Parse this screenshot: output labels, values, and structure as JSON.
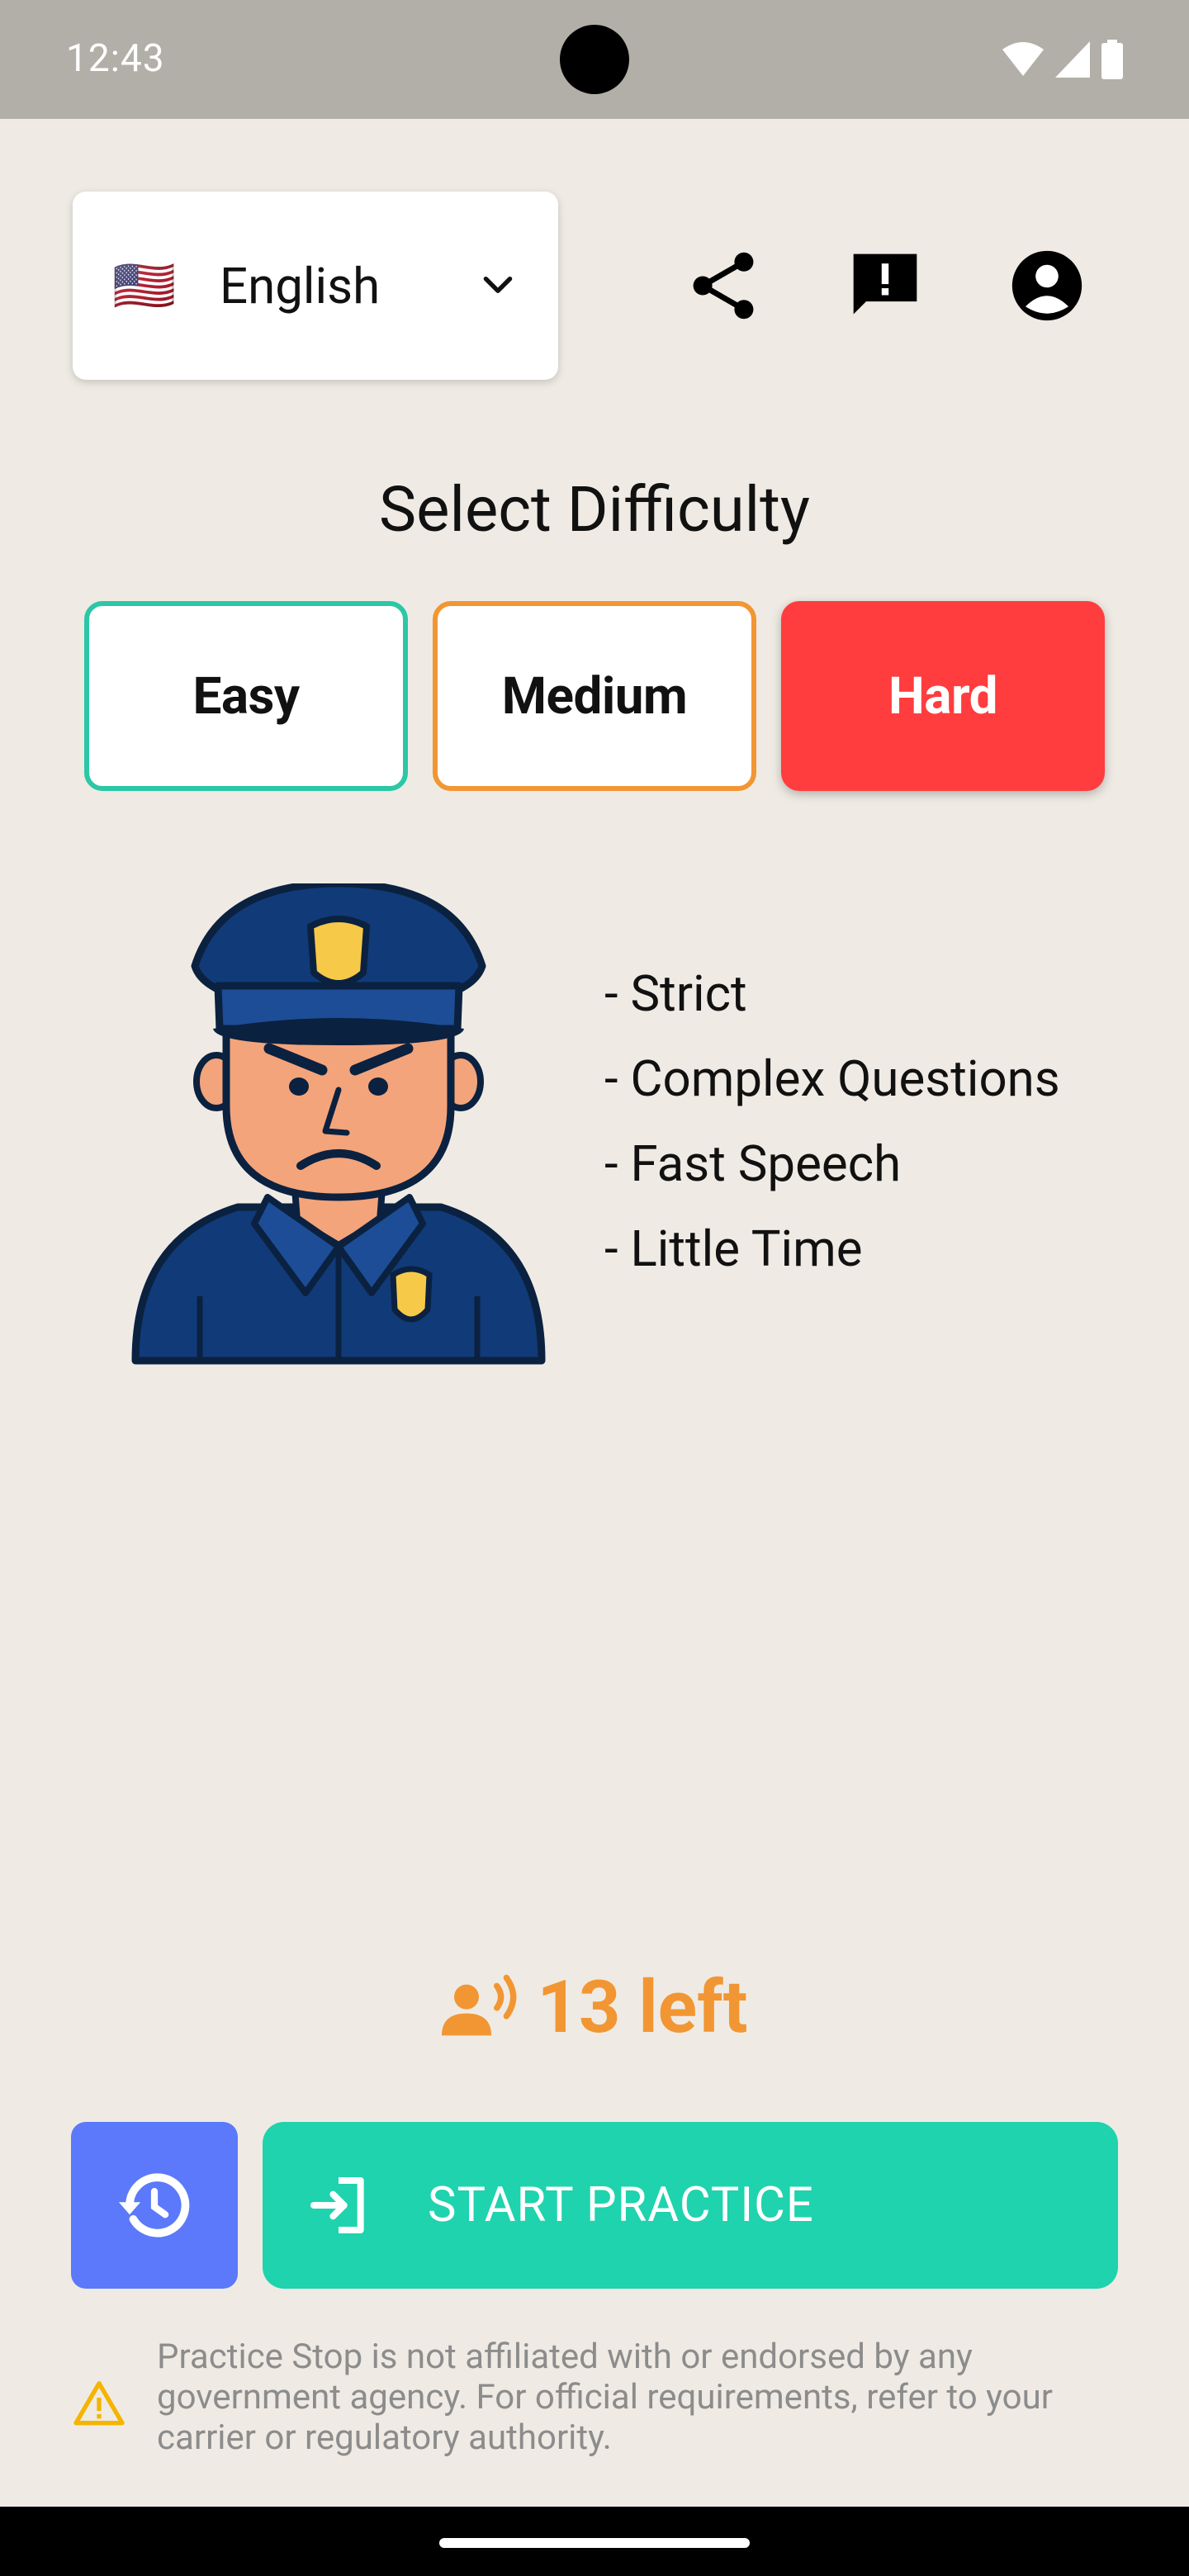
{
  "status_bar": {
    "time": "12:43"
  },
  "language": {
    "flag": "🇺🇸",
    "label": "English"
  },
  "header_icons": [
    "share-icon",
    "feedback-icon",
    "account-icon"
  ],
  "title": "Select Difficulty",
  "difficulty": {
    "easy": "Easy",
    "medium": "Medium",
    "hard": "Hard",
    "selected": "Hard"
  },
  "traits": [
    "- Strict",
    "- Complex Questions",
    "- Fast Speech",
    "- Little Time"
  ],
  "remaining": {
    "text": "13 left"
  },
  "actions": {
    "start_label": "START PRACTICE"
  },
  "disclaimer": "Practice Stop is not affiliated with or endorsed by any government agency. For official requirements, refer to your carrier or regulatory authority.",
  "colors": {
    "background": "#EFEBE4",
    "easy_border": "#2BC7A6",
    "medium_border": "#F29633",
    "hard_fill": "#FF3D3E",
    "history_button": "#5B79FA",
    "start_button": "#1ED3AE",
    "remaining_text": "#F29633"
  }
}
